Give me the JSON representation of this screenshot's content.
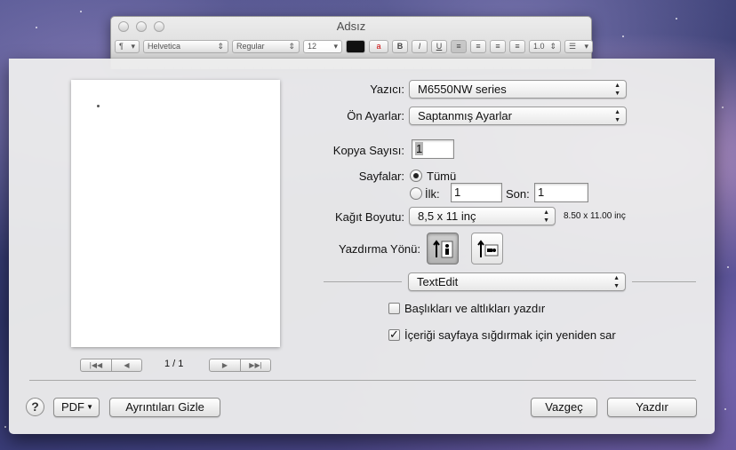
{
  "textedit": {
    "title": "Adsız",
    "toolbar": {
      "paragraph": "¶",
      "font": "Helvetica",
      "style": "Regular",
      "size": "12",
      "bold": "B",
      "italic": "I",
      "underline": "U",
      "spacing": "1.0",
      "list_icon": "list-icon"
    }
  },
  "print": {
    "printer_label": "Yazıcı:",
    "printer_value": "M6550NW series",
    "presets_label": "Ön Ayarlar:",
    "presets_value": "Saptanmış Ayarlar",
    "copies_label": "Kopya Sayısı:",
    "copies_value": "1",
    "pages_label": "Sayfalar:",
    "pages_all": "Tümü",
    "pages_from_label": "İlk:",
    "pages_from_value": "1",
    "pages_to_label": "Son:",
    "pages_to_value": "1",
    "paper_label": "Kağıt Boyutu:",
    "paper_value": "8,5 x 11 inç",
    "paper_dims": "8.50 x 11.00 inç",
    "orientation_label": "Yazdırma Yönü:",
    "orientation_selected": "portrait",
    "app_section": "TextEdit",
    "opt_headers": "Başlıkları ve altlıkları yazdır",
    "opt_headers_checked": false,
    "opt_rewrap": "İçeriği sayfaya sığdırmak için yeniden sar",
    "opt_rewrap_checked": true,
    "page_indicator": "1 / 1"
  },
  "footer": {
    "help": "?",
    "pdf": "PDF",
    "hide_details": "Ayrıntıları Gizle",
    "cancel": "Vazgeç",
    "print": "Yazdır"
  }
}
